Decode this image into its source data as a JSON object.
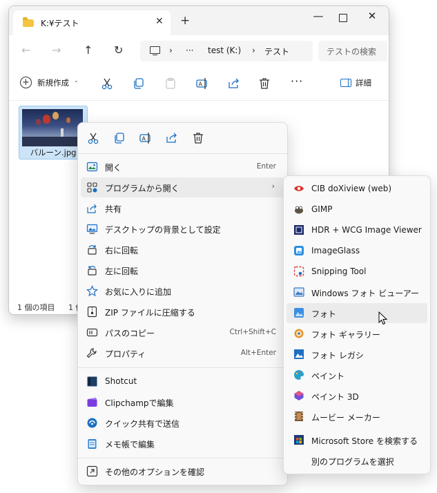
{
  "window": {
    "tab_title": "K:¥テスト",
    "new_tab": "+",
    "close_tab": "✕",
    "controls": {
      "minimize": "—",
      "close": "✕"
    }
  },
  "nav": {
    "back": "←",
    "forward": "→",
    "up": "↑",
    "refresh": "↻",
    "breadcrumb": [
      "test (K:)",
      "テスト"
    ],
    "ellipsis": "···",
    "sep": "›",
    "search_placeholder": "テストの検索"
  },
  "toolbar": {
    "new_label": "新規作成",
    "new_chevron": "⌄",
    "more": "···",
    "details_label": "詳細"
  },
  "file": {
    "name": "バルーン.jpg"
  },
  "status": {
    "items": "1 個の項目",
    "selected": "1 個"
  },
  "context_menu": {
    "items": [
      {
        "label": "開く",
        "shortcut": "Enter",
        "icon": "open-icon"
      },
      {
        "label": "プログラムから開く",
        "shortcut": "",
        "icon": "open-with-icon",
        "submenu": true
      },
      {
        "label": "共有",
        "shortcut": "",
        "icon": "share-icon"
      },
      {
        "label": "デスクトップの背景として設定",
        "shortcut": "",
        "icon": "wallpaper-icon"
      },
      {
        "label": "右に回転",
        "shortcut": "",
        "icon": "rotate-right-icon"
      },
      {
        "label": "左に回転",
        "shortcut": "",
        "icon": "rotate-left-icon"
      },
      {
        "label": "お気に入りに追加",
        "shortcut": "",
        "icon": "star-icon"
      },
      {
        "label": "ZIP ファイルに圧縮する",
        "shortcut": "",
        "icon": "zip-icon"
      },
      {
        "label": "パスのコピー",
        "shortcut": "Ctrl+Shift+C",
        "icon": "copy-path-icon"
      },
      {
        "label": "プロパティ",
        "shortcut": "Alt+Enter",
        "icon": "properties-icon"
      },
      {
        "label": "Shotcut",
        "shortcut": "",
        "icon": "shotcut-icon"
      },
      {
        "label": "Clipchampで編集",
        "shortcut": "",
        "icon": "clipchamp-icon"
      },
      {
        "label": "クイック共有で送信",
        "shortcut": "",
        "icon": "quick-share-icon"
      },
      {
        "label": "メモ帳で編集",
        "shortcut": "",
        "icon": "notepad-icon"
      },
      {
        "label": "その他のオプションを確認",
        "shortcut": "",
        "icon": "more-options-icon"
      }
    ],
    "submenu_arrow": "›"
  },
  "open_with": {
    "items": [
      {
        "label": "CIB doXiview (web)",
        "color": "#d9342b"
      },
      {
        "label": "GIMP",
        "color": "#5c5543"
      },
      {
        "label": "HDR + WCG Image Viewer",
        "color": "#1b2a6b"
      },
      {
        "label": "ImageGlass",
        "color": "#2d8fe0"
      },
      {
        "label": "Snipping Tool",
        "color": "#d93a3a"
      },
      {
        "label": "Windows フォト ビューアー",
        "color": "#3a78c2"
      },
      {
        "label": "フォト",
        "color": "#3b8fe0"
      },
      {
        "label": "フォト ギャラリー",
        "color": "#e8932a"
      },
      {
        "label": "フォト レガシ",
        "color": "#1f6fc2"
      },
      {
        "label": "ペイント",
        "color": "#2aa1c9"
      },
      {
        "label": "ペイント 3D",
        "color": "#6e4fd6"
      },
      {
        "label": "ムービー メーカー",
        "color": "#7a5a3a"
      },
      {
        "label": "Microsoft Store を検索する",
        "color": "#1f3a78"
      },
      {
        "label": "別のプログラムを選択",
        "color": ""
      }
    ]
  }
}
